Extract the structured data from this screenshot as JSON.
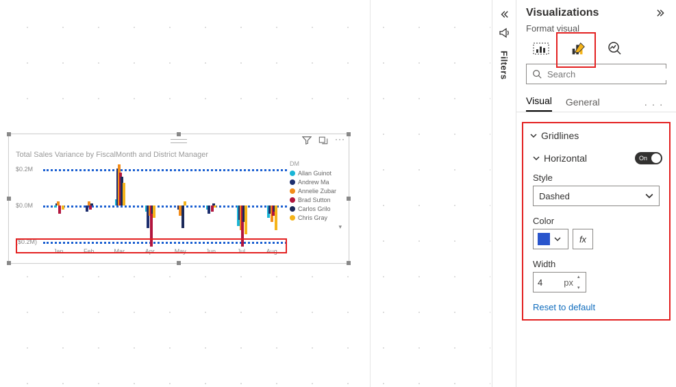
{
  "canvas": {
    "visual_title": "Total Sales Variance by FiscalMonth and District Manager"
  },
  "chart_data": {
    "type": "bar",
    "title": "Total Sales Variance by FiscalMonth and District Manager",
    "xlabel": "",
    "ylabel": "",
    "ylim": [
      -0.2,
      0.2
    ],
    "y_ticks": [
      "$0.2M",
      "$0.0M",
      "($0.2M)"
    ],
    "categories": [
      "Jan",
      "Feb",
      "Mar",
      "Apr",
      "May",
      "Jun",
      "Jul",
      "Aug"
    ],
    "legend_title": "DM",
    "series": [
      {
        "name": "Allan Guinot",
        "color": "#19b5d6",
        "values": [
          -0.01,
          0.0,
          0.03,
          -0.03,
          0.0,
          -0.02,
          -0.1,
          -0.06
        ]
      },
      {
        "name": "Andrew Ma",
        "color": "#1d2f6f",
        "values": [
          0.01,
          -0.03,
          0.18,
          -0.11,
          -0.02,
          -0.04,
          -0.07,
          -0.04
        ]
      },
      {
        "name": "Annelie Zubar",
        "color": "#f28c1a",
        "values": [
          0.02,
          0.02,
          0.2,
          -0.05,
          -0.05,
          0.0,
          -0.12,
          -0.08
        ]
      },
      {
        "name": "Brad Sutton",
        "color": "#b2153d",
        "values": [
          -0.04,
          -0.02,
          0.16,
          -0.2,
          0.0,
          -0.03,
          -0.2,
          -0.05
        ]
      },
      {
        "name": "Carlos Grilo",
        "color": "#1b2959",
        "values": [
          0.0,
          0.01,
          0.14,
          -0.04,
          -0.11,
          0.01,
          -0.08,
          -0.03
        ]
      },
      {
        "name": "Chris Gray",
        "color": "#f5b41a",
        "values": [
          -0.02,
          0.0,
          0.11,
          -0.06,
          0.02,
          -0.01,
          -0.14,
          -0.12
        ]
      }
    ],
    "gridlines": {
      "horizontal": {
        "style": "Dashed",
        "color": "#1a5fd1",
        "width": 4
      }
    }
  },
  "filters": {
    "label": "Filters"
  },
  "viz_pane": {
    "title": "Visualizations",
    "subhead": "Format visual",
    "search_placeholder": "Search",
    "tabs": {
      "visual": "Visual",
      "general": "General"
    },
    "gridlines": {
      "header": "Gridlines",
      "horizontal_label": "Horizontal",
      "toggle_text": "On",
      "style_label": "Style",
      "style_value": "Dashed",
      "color_label": "Color",
      "color_value": "#2955cc",
      "fx_label": "fx",
      "width_label": "Width",
      "width_value": "4",
      "width_unit": "px",
      "reset_label": "Reset to default"
    }
  }
}
